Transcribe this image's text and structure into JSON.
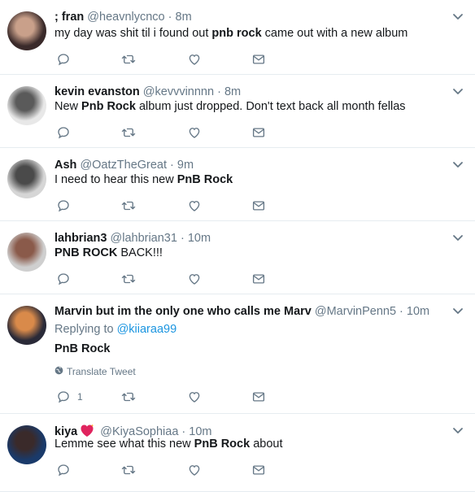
{
  "tweets": [
    {
      "name": "; fran",
      "handle": "@heavnlycnco",
      "time": "8m",
      "segments": [
        {
          "t": "my day was shit til i found out ",
          "b": false
        },
        {
          "t": "pnb rock",
          "b": true
        },
        {
          "t": " came out with a new album",
          "b": false
        }
      ],
      "reply_count": "",
      "avatar_colors": [
        "#3a2a2a",
        "#c9a08a"
      ]
    },
    {
      "name": "kevin evanston",
      "handle": "@kevvvinnnn",
      "time": "8m",
      "segments": [
        {
          "t": "New ",
          "b": false
        },
        {
          "t": "Pnb Rock",
          "b": true
        },
        {
          "t": " album just dropped. Don't text back all month fellas",
          "b": false
        }
      ],
      "reply_count": "",
      "avatar_colors": [
        "#e8e8e8",
        "#5a5a5a"
      ]
    },
    {
      "name": "Ash",
      "handle": "@OatzTheGreat",
      "time": "9m",
      "segments": [
        {
          "t": "I need to hear this new ",
          "b": false
        },
        {
          "t": "PnB Rock",
          "b": true
        }
      ],
      "reply_count": "",
      "avatar_colors": [
        "#d6d6d6",
        "#4a4a4a"
      ]
    },
    {
      "name": "lahbrian3",
      "handle": "@lahbrian31",
      "time": "10m",
      "segments": [
        {
          "t": "PNB ROCK",
          "b": true
        },
        {
          "t": " BACK!!!",
          "b": false
        }
      ],
      "reply_count": "",
      "avatar_colors": [
        "#cfcfcf",
        "#8a5a4a"
      ]
    },
    {
      "name": "Marvin but im the only one who calls me Marv",
      "handle": "@MarvinPenn5",
      "time": "10m",
      "replying_prefix": "Replying to ",
      "replying_to": "@kiiaraa99",
      "segments": [
        {
          "t": "PnB Rock",
          "b": true
        }
      ],
      "translate": "Translate Tweet",
      "reply_count": "1",
      "avatar_colors": [
        "#2a2a38",
        "#d98a4a"
      ]
    },
    {
      "name": "kiya",
      "handle": "@KiyaSophiaa",
      "time": "10m",
      "segments": [
        {
          "t": "Lemme see what this new ",
          "b": false
        },
        {
          "t": "PnB Rock",
          "b": true
        },
        {
          "t": " about",
          "b": false
        }
      ],
      "reply_count": "",
      "has_heart": true,
      "avatar_colors": [
        "#1a3a6a",
        "#3a2a2a"
      ]
    }
  ],
  "icons": {
    "reply": "reply-icon",
    "retweet": "retweet-icon",
    "like": "like-icon",
    "dm": "direct-message-icon",
    "caret": "chevron-down-icon",
    "globe": "globe-icon",
    "heart": "sparkling-heart-icon"
  },
  "colors": {
    "icon_gray": "#657786",
    "link_blue": "#1b95e0",
    "heart_pink": "#e0245e"
  }
}
